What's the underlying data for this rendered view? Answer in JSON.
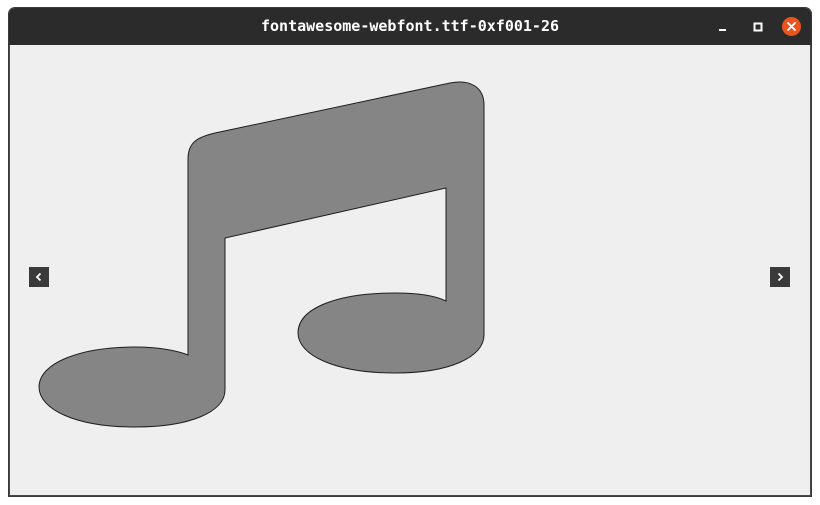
{
  "window": {
    "title": "fontawesome-webfont.ttf-0xf001-26"
  },
  "controls": {
    "minimize_icon": "minimize-icon",
    "maximize_icon": "maximize-icon",
    "close_icon": "close-icon",
    "close_color": "#e9541f"
  },
  "viewer": {
    "glyph_icon": "music-note-icon",
    "glyph_color": "#858585",
    "background_color": "#efefef",
    "prev_icon": "chevron-left-icon",
    "next_icon": "chevron-right-icon"
  }
}
